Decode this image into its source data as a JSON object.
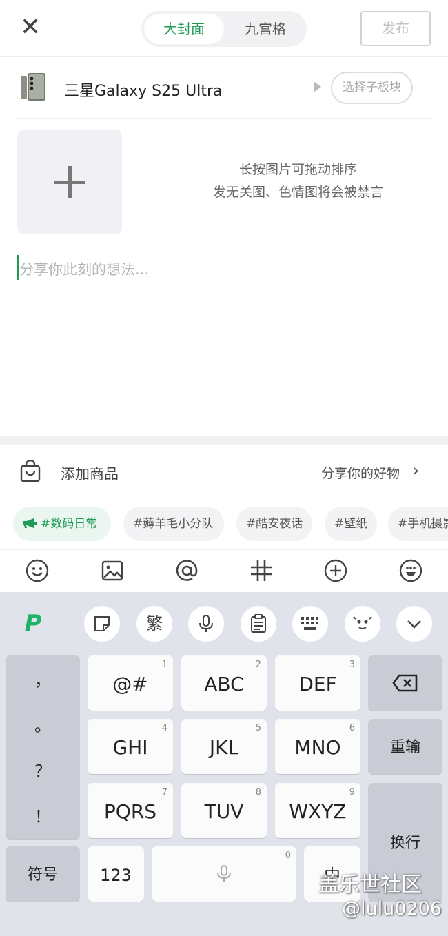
{
  "header": {
    "close_icon": "close-icon",
    "tab_cover": "大封面",
    "tab_grid": "九宫格",
    "publish": "发布"
  },
  "board": {
    "name": "三星Galaxy S25 Ultra",
    "sub_board": "选择子板块"
  },
  "media": {
    "hint_line1": "长按图片可拖动排序",
    "hint_line2": "发无关图、色情图将会被禁言"
  },
  "editor": {
    "placeholder": "分享你此刻的想法..."
  },
  "goods": {
    "label": "添加商品",
    "action": "分享你的好物"
  },
  "tags": [
    "#数码日常",
    "#薅羊毛小分队",
    "#酷安夜话",
    "#壁纸",
    "#手机摄影"
  ],
  "toolbar": [
    "emoji-icon",
    "image-icon",
    "at-icon",
    "hashtag-icon",
    "add-circle-icon",
    "sticker-icon"
  ],
  "keyboard": {
    "top_row": [
      "logo-icon",
      "sticker-icon",
      "繁",
      "mic-icon",
      "clipboard-icon",
      "keyboard-icon",
      "emoji-face-icon",
      "chevron-down-icon"
    ],
    "trad": "繁",
    "punct": [
      "，",
      "。",
      "？",
      "！"
    ],
    "keys": [
      {
        "label": "@#",
        "num": "1"
      },
      {
        "label": "ABC",
        "num": "2"
      },
      {
        "label": "DEF",
        "num": "3"
      },
      {
        "label": "GHI",
        "num": "4"
      },
      {
        "label": "JKL",
        "num": "5"
      },
      {
        "label": "MNO",
        "num": "6"
      },
      {
        "label": "PQRS",
        "num": "7"
      },
      {
        "label": "TUV",
        "num": "8"
      },
      {
        "label": "WXYZ",
        "num": "9"
      }
    ],
    "backspace_icon": "backspace-icon",
    "reinput": "重输",
    "newline": "换行",
    "symbols": "符号",
    "num_key": "123",
    "space_num": "0",
    "lang": "中"
  },
  "watermark": {
    "line1": "盖乐世社区",
    "line2": "@lulu0206"
  },
  "colors": {
    "accent": "#1f9b57",
    "keyboard_bg": "#e1e3ea"
  }
}
